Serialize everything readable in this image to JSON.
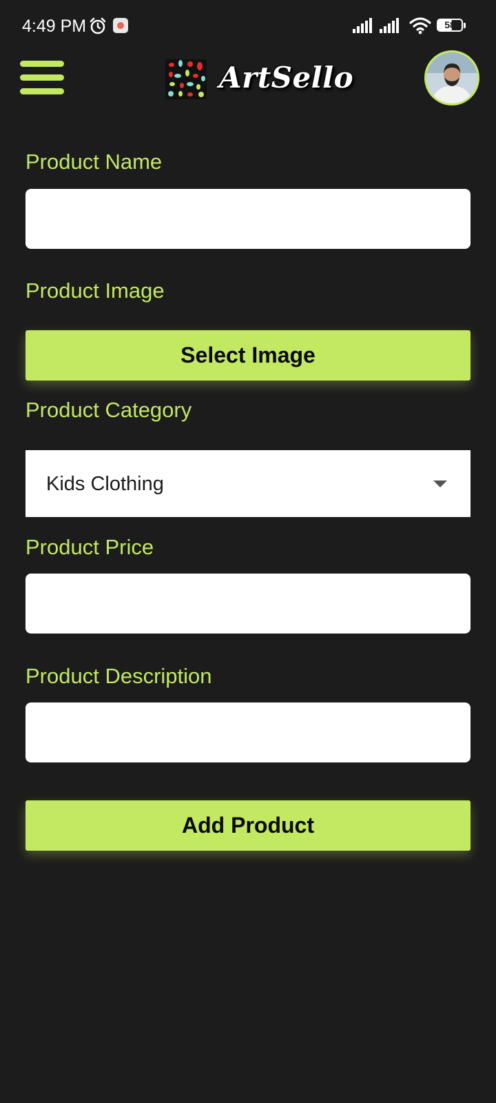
{
  "status_bar": {
    "time": "4:49 PM",
    "battery_level": "58",
    "icons": [
      "alarm-icon",
      "notification-icon",
      "signal-icon",
      "signal-icon",
      "wifi-icon",
      "battery-icon"
    ]
  },
  "header": {
    "brand_name": "ArtSello",
    "menu_icon": "hamburger-menu-icon",
    "avatar_icon": "profile-avatar"
  },
  "form": {
    "product_name": {
      "label": "Product Name",
      "value": "",
      "placeholder": ""
    },
    "product_image": {
      "label": "Product Image",
      "button_label": "Select Image"
    },
    "product_category": {
      "label": "Product Category",
      "selected": "Kids Clothing"
    },
    "product_price": {
      "label": "Product Price",
      "value": "",
      "placeholder": ""
    },
    "product_description": {
      "label": "Product Description",
      "value": "",
      "placeholder": ""
    },
    "submit_label": "Add Product"
  },
  "colors": {
    "accent": "#c3e862",
    "background": "#1c1c1c",
    "input_background": "#ffffff",
    "button_text": "#0a0a0a"
  }
}
